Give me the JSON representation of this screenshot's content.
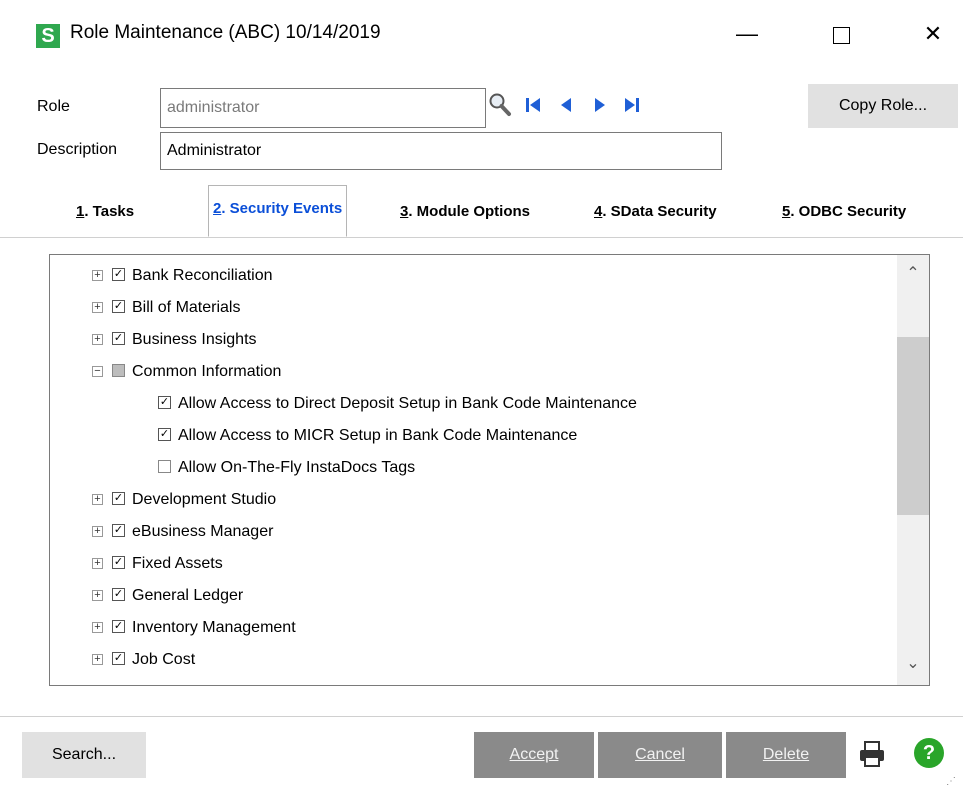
{
  "window": {
    "app_icon_letter": "S",
    "title": "Role Maintenance (ABC) 10/14/2019",
    "minimize": "—",
    "close": "✕"
  },
  "form": {
    "role_label": "Role",
    "role_value": "administrator",
    "description_label": "Description",
    "description_value": "Administrator",
    "copy_role_label": "Copy Role..."
  },
  "tabs": [
    {
      "num": "1",
      "label": ". Tasks",
      "active": false
    },
    {
      "num": "2",
      "label": ". Security Events",
      "active": true
    },
    {
      "num": "3",
      "label": ". Module Options",
      "active": false
    },
    {
      "num": "4",
      "label": ". SData Security",
      "active": false
    },
    {
      "num": "5",
      "label": ". ODBC Security",
      "active": false
    }
  ],
  "tree": {
    "items": [
      {
        "label": "Bank Reconciliation",
        "expander": "+",
        "state": "checked",
        "level": 0
      },
      {
        "label": "Bill of Materials",
        "expander": "+",
        "state": "checked",
        "level": 0
      },
      {
        "label": "Business Insights",
        "expander": "+",
        "state": "checked",
        "level": 0
      },
      {
        "label": "Common Information",
        "expander": "−",
        "state": "partial",
        "level": 0
      },
      {
        "label": "Allow Access to Direct Deposit Setup in Bank Code Maintenance",
        "expander": "",
        "state": "checked",
        "level": 1
      },
      {
        "label": "Allow Access to MICR Setup in Bank Code Maintenance",
        "expander": "",
        "state": "checked",
        "level": 1
      },
      {
        "label": "Allow On-The-Fly InstaDocs Tags",
        "expander": "",
        "state": "unchecked",
        "level": 1
      },
      {
        "label": "Development Studio",
        "expander": "+",
        "state": "checked",
        "level": 0
      },
      {
        "label": "eBusiness Manager",
        "expander": "+",
        "state": "checked",
        "level": 0
      },
      {
        "label": "Fixed Assets",
        "expander": "+",
        "state": "checked",
        "level": 0
      },
      {
        "label": "General Ledger",
        "expander": "+",
        "state": "checked",
        "level": 0
      },
      {
        "label": "Inventory Management",
        "expander": "+",
        "state": "checked",
        "level": 0
      },
      {
        "label": "Job Cost",
        "expander": "+",
        "state": "checked",
        "level": 0
      }
    ]
  },
  "buttons": {
    "search": "Search...",
    "accept": "Accept",
    "cancel": "Cancel",
    "delete": "Delete"
  },
  "colors": {
    "accent_tab": "#0b4fd8",
    "app_icon": "#2fa84f",
    "help_icon": "#2aa52a",
    "disabled_button": "#8a8a8a"
  }
}
